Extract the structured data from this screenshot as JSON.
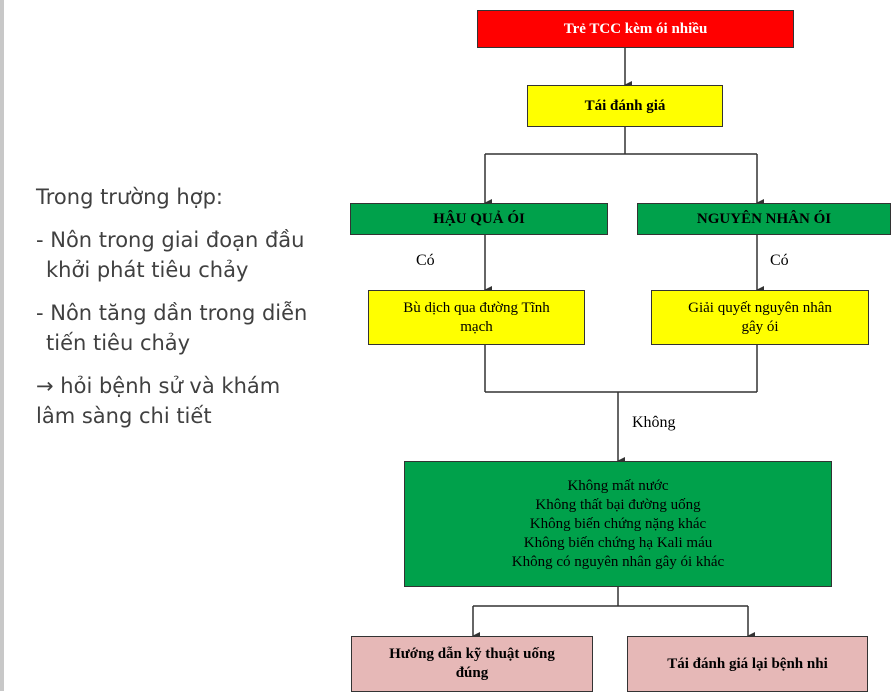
{
  "left_text": {
    "heading": "Trong trường hợp:",
    "bullet1_line1": "- Nôn trong giai đoạn đầu",
    "bullet1_line2": "khởi phát tiêu chảy",
    "bullet2_line1": "- Nôn tăng dần trong diễn",
    "bullet2_line2": "tiến tiêu chảy",
    "arrow_glyph": "→",
    "conclusion_line1": "hỏi bệnh sử và khám",
    "conclusion_line2": "lâm sàng chi tiết"
  },
  "flowchart": {
    "top": "Trẻ TCC kèm ói nhiều",
    "reassess": "Tái đánh giá",
    "consequence": "HẬU QUẢ ÓI",
    "cause": "NGUYÊN NHÂN ÓI",
    "yes_left": "Có",
    "yes_right": "Có",
    "iv_line1": "Bù dịch qua đường Tĩnh",
    "iv_line2": "mạch",
    "resolve_line1": "Giải quyết nguyên nhân",
    "resolve_line2": "gây ói",
    "no_label": "Không",
    "conditions": [
      "Không mất nước",
      "Không thất bại đường uống",
      "Không biến chứng nặng khác",
      "Không biến chứng hạ Kali máu",
      "Không có nguyên nhân gây ói khác"
    ],
    "guide_line1": "Hướng dẫn kỹ thuật uống",
    "guide_line2": "đúng",
    "reassess_child": "Tái đánh giá lại bệnh nhi"
  },
  "colors": {
    "red": "#ff0000",
    "yellow": "#ffff00",
    "green": "#00a14b",
    "pink": "#e6b8b7"
  }
}
